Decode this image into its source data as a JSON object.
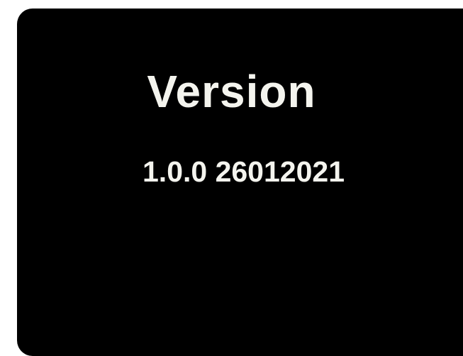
{
  "screen": {
    "title": "Version",
    "version": "1.0.0 26012021",
    "background_color": "#000000",
    "text_color": "#f4f4ee"
  }
}
